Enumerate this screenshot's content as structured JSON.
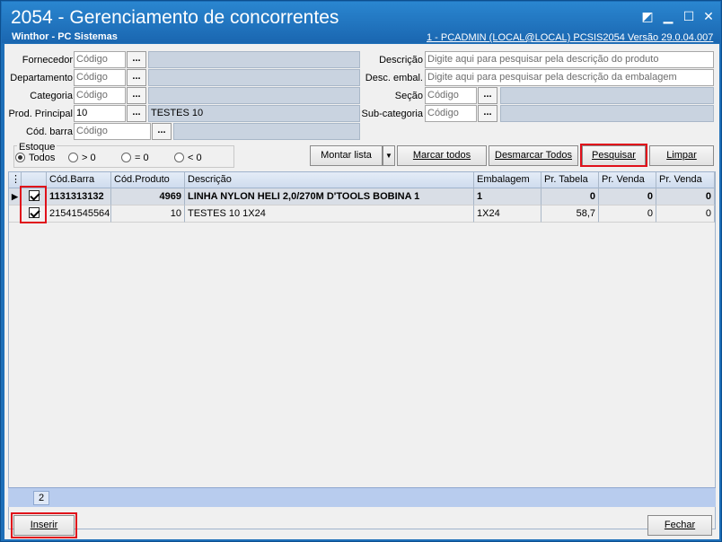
{
  "window": {
    "title": "2054 - Gerenciamento de concorrentes",
    "subtitle": "Winthor - PC Sistemas",
    "user_info": "1 - PCADMIN (LOCAL@LOCAL)   PCSIS2054  Versão  29.0.04.007",
    "controls": [
      "restore-icon",
      "minimize-icon",
      "maximize-icon",
      "close-icon"
    ]
  },
  "filters": {
    "fornecedor": {
      "label": "Fornecedor",
      "placeholder": "Código",
      "value": ""
    },
    "departamento": {
      "label": "Departamento",
      "placeholder": "Código",
      "value": ""
    },
    "categoria": {
      "label": "Categoria",
      "placeholder": "Código",
      "value": ""
    },
    "prod_principal": {
      "label": "Prod. Principal",
      "value": "10",
      "description": "TESTES 10"
    },
    "cod_barra": {
      "label": "Cód. barra",
      "placeholder": "Código",
      "value": ""
    },
    "descricao": {
      "label": "Descrição",
      "placeholder": "Digite aqui para pesquisar pela descrição do produto"
    },
    "desc_embal": {
      "label": "Desc. embal.",
      "placeholder": "Digite aqui para pesquisar pela descrição da embalagem"
    },
    "secao": {
      "label": "Seção",
      "placeholder": "Código"
    },
    "subcategoria": {
      "label": "Sub-categoria",
      "placeholder": "Código"
    },
    "dots_label": "..."
  },
  "estoque": {
    "title": "Estoque",
    "options": [
      {
        "label": "Todos",
        "selected": true
      },
      {
        "label": "> 0",
        "selected": false
      },
      {
        "label": "= 0",
        "selected": false
      },
      {
        "label": "< 0",
        "selected": false
      }
    ]
  },
  "actions": {
    "montar_lista": "Montar lista",
    "marcar_todos": "Marcar todos",
    "desmarcar_todos": "Desmarcar Todos",
    "pesquisar": "Pesquisar",
    "limpar": "Limpar"
  },
  "grid": {
    "columns": [
      "",
      "Cód.Barra",
      "Cód.Produto",
      "Descrição",
      "Embalagem",
      "Pr. Tabela",
      "Pr. Venda",
      "Pr. Venda"
    ],
    "rows": [
      {
        "checked": true,
        "cod_barra": "1131313132",
        "cod_produto": "4969",
        "descricao": "LINHA NYLON HELI 2,0/270M D'TOOLS BOBINA 1",
        "embalagem": "1",
        "pr_tabela": "0",
        "pr_venda1": "0",
        "pr_venda2": "0",
        "current": true
      },
      {
        "checked": true,
        "cod_barra": "21541545564",
        "cod_produto": "10",
        "descricao": "TESTES 10 1X24",
        "embalagem": "1X24",
        "pr_tabela": "58,7",
        "pr_venda1": "0",
        "pr_venda2": "0",
        "current": false
      }
    ],
    "record_count": "2"
  },
  "footer": {
    "inserir": "Inserir",
    "fechar": "Fechar"
  },
  "colors": {
    "titlebar": "#1e6fb8",
    "highlight": "#e0101a",
    "grid_footer": "#b8ccee"
  }
}
